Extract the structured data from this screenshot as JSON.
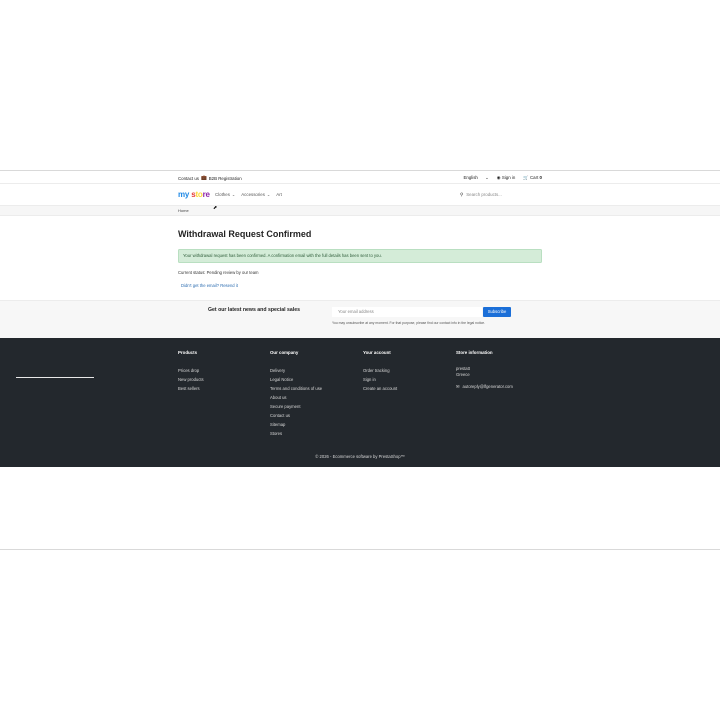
{
  "topbar": {
    "contact": "Contact us",
    "b2b": "B2B Registration",
    "language": "English",
    "signin": "Sign in",
    "cart_label": "Cart",
    "cart_count": "0"
  },
  "header": {
    "logo": [
      "my",
      " ",
      "s",
      "to",
      "re"
    ],
    "nav": [
      "Clothes",
      "Accessories",
      "Art"
    ],
    "search_placeholder": "Search products..."
  },
  "breadcrumb": {
    "home": "Home"
  },
  "main": {
    "title": "Withdrawal Request Confirmed",
    "alert": "Your withdrawal request has been confirmed. A confirmation email with the full details has been sent to you.",
    "status": "Current status:  Pending review by our team",
    "resend": "Didn't get the email? Resend it"
  },
  "newsletter": {
    "title": "Get our latest news and special sales",
    "placeholder": "Your email address",
    "button": "Subscribe",
    "note": "You may unsubscribe at any moment. For that purpose, please find our contact info in the legal notice."
  },
  "footer": {
    "products": {
      "title": "Products",
      "items": [
        "Prices drop",
        "New products",
        "Best sellers"
      ]
    },
    "company": {
      "title": "Our company",
      "items": [
        "Delivery",
        "Legal Notice",
        "Terms and conditions of use",
        "About us",
        "Secure payment",
        "Contact us",
        "Sitemap",
        "Stores"
      ]
    },
    "account": {
      "title": "Your account",
      "items": [
        "Order tracking",
        "Sign in",
        "Create an account"
      ]
    },
    "store": {
      "title": "Store information",
      "name": "prestatt",
      "country": "Greece",
      "email": "autoreply@lfgenerator.com"
    },
    "copyright": "© 2026 - Ecommerce software by PrestaShop™"
  },
  "colors": {
    "accent": "#1b6fd8",
    "footer_bg": "#23282d",
    "alert_bg": "#d4ecd8"
  }
}
